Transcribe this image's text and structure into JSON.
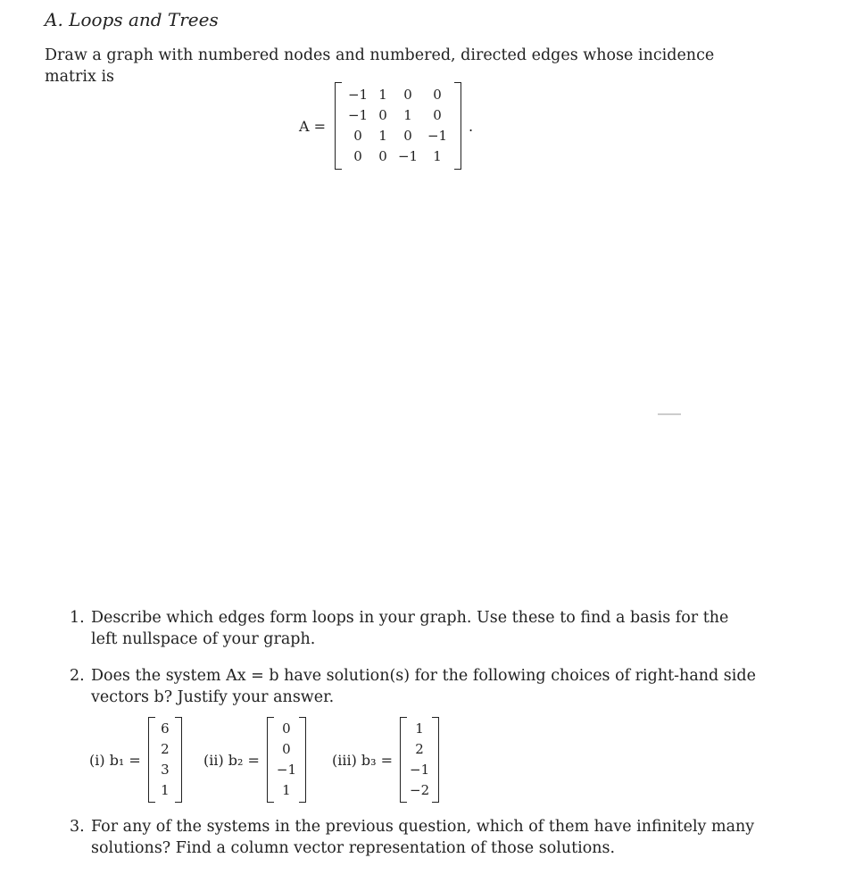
{
  "title": "A. Loops and Trees",
  "intro": "Draw a graph with numbered nodes and numbered, directed edges whose incidence matrix is",
  "matrix": {
    "label": "A =",
    "rows": [
      [
        "−1",
        "1",
        "0",
        "0"
      ],
      [
        "−1",
        "0",
        "1",
        "0"
      ],
      [
        "0",
        "1",
        "0",
        "−1"
      ],
      [
        "0",
        "0",
        "−1",
        "1"
      ]
    ],
    "trailing": "."
  },
  "questions": [
    {
      "num": "1.",
      "text": "Describe which edges form loops in your graph. Use these to find a basis for the left nullspace of your graph."
    },
    {
      "num": "2.",
      "text": "Does the system Ax = b have solution(s) for the following choices of right-hand side vectors b? Justify your answer."
    },
    {
      "num": "3.",
      "text": "For any of the systems in the previous question, which of them have infinitely many solutions? Find a column vector representation of those solutions."
    }
  ],
  "vectors": [
    {
      "label": "(i) b₁ =",
      "values": [
        "6",
        "2",
        "3",
        "1"
      ]
    },
    {
      "label": "(ii) b₂ =",
      "values": [
        "0",
        "0",
        "−1",
        "1"
      ]
    },
    {
      "label": "(iii) b₃ =",
      "values": [
        "1",
        "2",
        "−1",
        "−2"
      ]
    }
  ]
}
